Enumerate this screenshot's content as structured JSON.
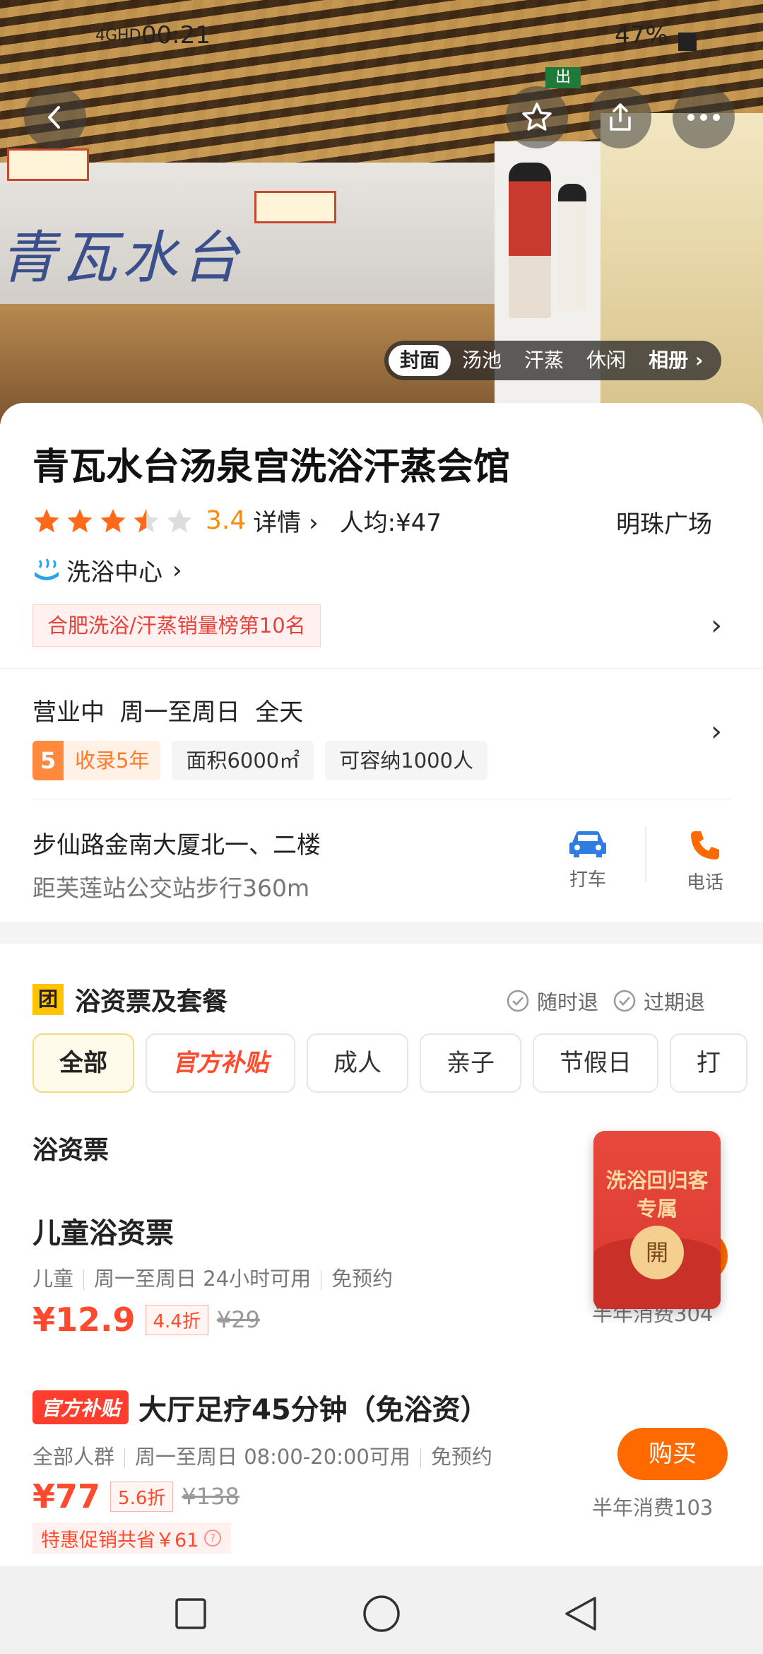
{
  "status_bar": {
    "network": "4GHD",
    "time": "00:21",
    "battery": "47%"
  },
  "hero": {
    "sign_text": "青瓦水台",
    "exit_sign": "出",
    "photo_tabs": [
      "封面",
      "汤池",
      "汗蒸",
      "休闲"
    ],
    "album_label": "相册"
  },
  "venue": {
    "name": "青瓦水台汤泉宫洗浴汗蒸会馆",
    "rating": 3.4,
    "rating_text": "3.4",
    "details_label": "详情",
    "avg_price": "人均:¥47",
    "area": "明珠广场",
    "category": "洗浴中心",
    "rank_badge": "合肥洗浴/汗蒸销量榜第10名",
    "hours": "营业中  周一至周日  全天",
    "years_number": "5",
    "years_label": "收录5年",
    "area_size": "面积6000㎡",
    "capacity": "可容纳1000人",
    "address": "步仙路金南大厦北一、二楼",
    "distance": "距芙莲站公交站步行360m",
    "taxi_label": "打车",
    "phone_label": "电话"
  },
  "deals": {
    "section_icon": "团",
    "section_title": "浴资票及套餐",
    "refund1": "随时退",
    "refund2": "过期退",
    "categories": [
      "全部",
      "官方补贴",
      "成人",
      "亲子",
      "节假日",
      "打"
    ],
    "subhead": "浴资票",
    "items": [
      {
        "title": "儿童浴资票",
        "meta": [
          "儿童",
          "周一至周日 24小时可用",
          "免预约"
        ],
        "price": "¥12.9",
        "discount": "4.4折",
        "original": "¥29",
        "sales": "半年消费304"
      },
      {
        "badge": "官方补贴",
        "title": "大厅足疗45分钟（免浴资）",
        "meta": [
          "全部人群",
          "周一至周日 08:00-20:00可用",
          "免预约"
        ],
        "price": "¥77",
        "discount": "5.6折",
        "original": "¥138",
        "promo": "特惠促销共省￥61",
        "buy_label": "购买",
        "sales": "半年消费103"
      }
    ]
  },
  "popup": {
    "text": "洗浴回归客专属",
    "button": "開"
  },
  "colors": {
    "accent": "#ff6a00",
    "star": "#ff8a00",
    "red": "#ff4a2e",
    "taxi": "#2f7de1",
    "phone": "#ff6a00"
  }
}
